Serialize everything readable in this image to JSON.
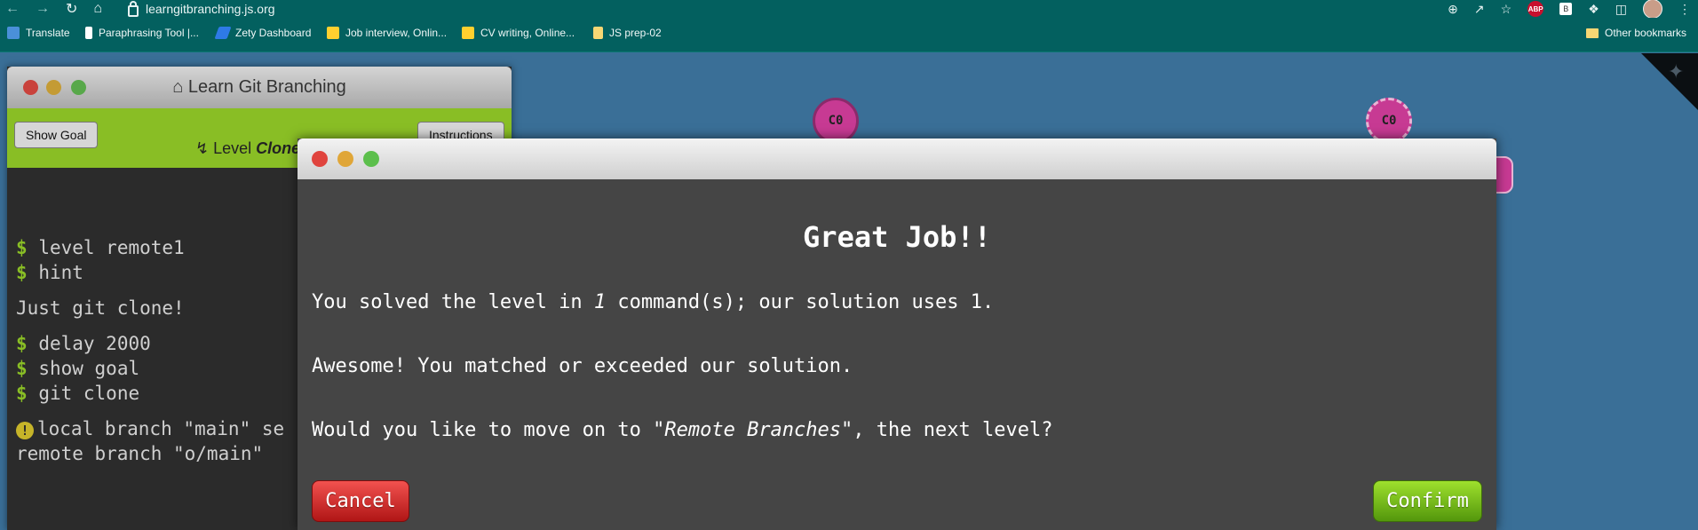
{
  "browser": {
    "url": "learngitbranching.js.org",
    "nav_icons": [
      "back-arrow-icon",
      "forward-arrow-icon",
      "reload-icon",
      "home-icon"
    ],
    "bookmarks": [
      {
        "label": "Translate",
        "icon": "translate-icon",
        "color": "#4a90d9"
      },
      {
        "label": "Paraphrasing Tool |...",
        "icon": "quill-icon",
        "color": "#ffffff"
      },
      {
        "label": "Zety Dashboard",
        "icon": "zety-icon",
        "color": "#2e7ae6"
      },
      {
        "label": "Job interview, Onlin...",
        "icon": "miro-icon",
        "color": "#ffd02f"
      },
      {
        "label": "CV writing, Online...",
        "icon": "miro-icon",
        "color": "#ffd02f"
      },
      {
        "label": "JS prep-02",
        "icon": "doc-icon",
        "color": "#f7d774"
      }
    ],
    "other_bookmarks": "Other bookmarks",
    "ext_abp": "ABP",
    "ext_b": "B"
  },
  "terminal": {
    "title": "Learn Git Branching",
    "show_goal": "Show Goal",
    "level_prefix": "Level",
    "level_name": "Clone Intro",
    "instructions": "Instructions",
    "lines": {
      "l1": "level remote1",
      "l2": "hint",
      "l3": "Just git clone!",
      "l4": "delay 2000",
      "l5": "show goal",
      "l6": "git clone",
      "l7": "local branch \"main\" se",
      "l8": "remote branch \"o/main\""
    },
    "prompt": "$"
  },
  "visualization": {
    "commit_a": "C0",
    "commit_b": "C0"
  },
  "dialog": {
    "heading": "Great Job!!",
    "line1_pre": "You solved the level in ",
    "line1_num": "1",
    "line1_post": " command(s); our solution uses 1.",
    "line2": "Awesome! You matched or exceeded our solution.",
    "line3_pre": "Would you like to move on to ",
    "line3_level": "\"Remote Branches\"",
    "line3_post": ", the next level?",
    "cancel": "Cancel",
    "confirm": "Confirm"
  }
}
